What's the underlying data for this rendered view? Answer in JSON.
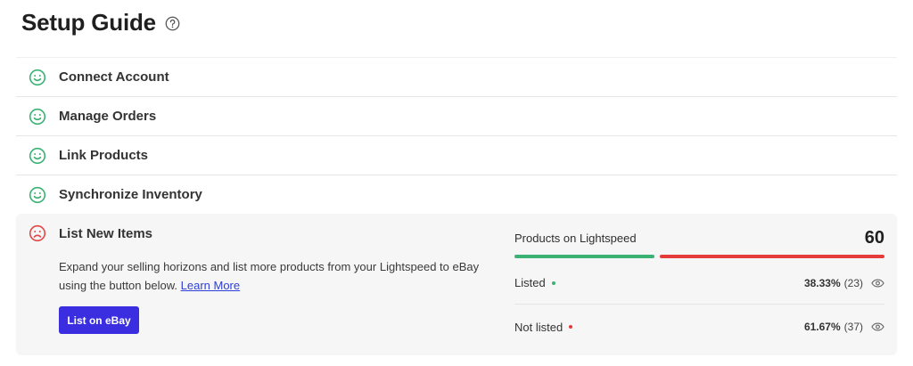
{
  "header": {
    "title": "Setup Guide"
  },
  "steps": [
    {
      "label": "Connect Account",
      "status": "complete"
    },
    {
      "label": "Manage Orders",
      "status": "complete"
    },
    {
      "label": "Link Products",
      "status": "complete"
    },
    {
      "label": "Synchronize Inventory",
      "status": "complete"
    }
  ],
  "active_step": {
    "label": "List New Items",
    "status": "incomplete",
    "description": "Expand your selling horizons and list more products from your Lightspeed to eBay using the button below.",
    "learn_more": "Learn More",
    "button": "List on eBay"
  },
  "stats": {
    "title": "Products on Lightspeed",
    "total": "60",
    "listed_fraction": 0.3833,
    "rows": [
      {
        "label": "Listed",
        "percent": "38.33%",
        "count": "(23)",
        "color": "#3bb273"
      },
      {
        "label": "Not listed",
        "percent": "61.67%",
        "count": "(37)",
        "color": "#e53b3b"
      }
    ]
  },
  "colors": {
    "complete": "#3bb273",
    "incomplete": "#e04848",
    "accent": "#3a2ee0",
    "link": "#2c3fd9"
  },
  "icons": {
    "complete": "smile-face-icon",
    "incomplete": "frown-face-icon",
    "help": "question-circle-icon",
    "view": "eye-icon"
  }
}
